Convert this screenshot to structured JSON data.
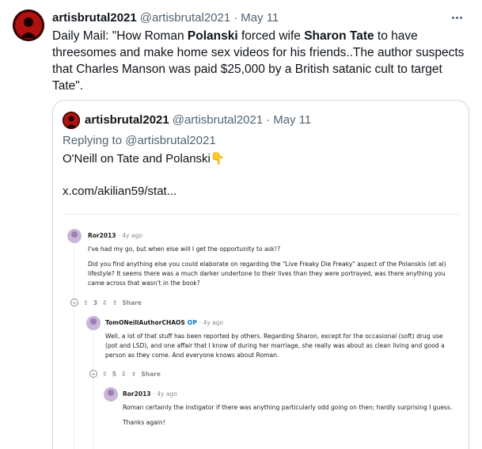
{
  "tweet": {
    "display_name": "artisbrutal2021",
    "handle": "@artisbrutal2021",
    "separator": "·",
    "date": "May 11",
    "text_parts": {
      "p1": "Daily Mail: \"How Roman ",
      "b1": "Polanski",
      "p2": " forced wife ",
      "b2": "Sharon Tate",
      "p3": " to have threesomes and make home sex videos for his friends..The author suspects that Charles Manson was paid $25,000 by a British satanic cult to target Tate\"."
    }
  },
  "quote": {
    "display_name": "artisbrutal2021",
    "handle": "@artisbrutal2021",
    "separator": "·",
    "date": "May 11",
    "replying_to": "Replying to @artisbrutal2021",
    "text": "O'Neill on Tate and Polanski",
    "emoji": "👇",
    "link": "x.com/akilian59/stat..."
  },
  "reddit": {
    "c1": {
      "user": "Ror2013",
      "ago": "· 4y ago",
      "p1": "I've had my go, but when else will I get the opportunity to ask!?",
      "p2": "Did you find anything else you could elaborate on regarding the \"Live Freaky Die Freaky\" aspect of the Polanskis (et al) lifestyle? It seems there was a much darker undertone to their lives than they were portrayed, was there anything you came across that wasn't in the book?",
      "votes": "3",
      "share": "Share"
    },
    "c2": {
      "user": "TomONeillAuthorCHAOS",
      "op": "OP",
      "ago": "· 4y ago",
      "p1": "Well, a lot of that stuff has been reported by others. Regarding Sharon, except for the occasional (soft) drug use (pot and LSD), and one affair that I know of during her marriage, she really was about as clean living and good a person as they come. And everyone knows about Roman.",
      "votes": "5",
      "share": "Share"
    },
    "c3": {
      "user": "Ror2013",
      "ago": "· 4y ago",
      "p1": "Roman certainly the instigator if there was anything particularly odd going on then; hardly surprising I guess.",
      "p2": "Thanks again!"
    }
  },
  "icons": {
    "more": "more-horizontal-icon",
    "upvote": "arrow-up-icon",
    "downvote": "arrow-down-icon",
    "share": "share-icon",
    "collapse": "collapse-minus-icon"
  },
  "colors": {
    "text": "#0f1419",
    "muted": "#536471",
    "border": "#cfd9de",
    "op_blue": "#0079d3"
  }
}
